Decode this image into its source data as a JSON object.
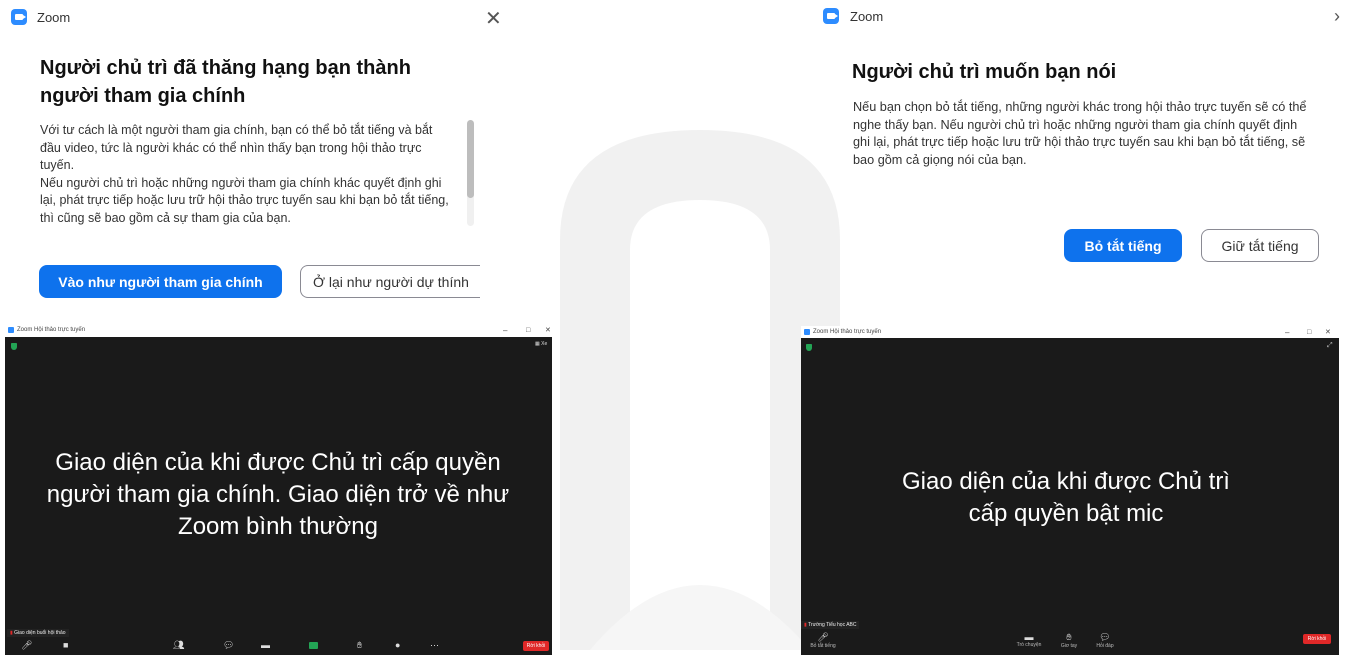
{
  "left_dialog": {
    "app_name": "Zoom",
    "title": "Người chủ trì đã thăng hạng bạn thành người tham gia chính",
    "body_p1": "Với tư cách là một người tham gia chính, bạn có thể bỏ tắt tiếng và bắt đầu video, tức là người khác có thể nhìn thấy bạn trong hội thảo trực tuyến.",
    "body_p2": "Nếu người chủ trì hoặc những người tham gia chính khác quyết định ghi lại, phát trực tiếp hoặc lưu trữ hội thảo trực tuyến sau khi bạn bỏ tắt tiếng, thì cũng sẽ bao gồm cả sự tham gia của bạn.",
    "primary_button": "Vào như người tham gia chính",
    "secondary_button": "Ở lại như người dự thính"
  },
  "right_dialog": {
    "app_name": "Zoom",
    "title": "Người chủ trì muốn bạn nói",
    "body": "Nếu bạn chọn bỏ tắt tiếng, những người khác trong hội thảo trực tuyến sẽ có thể nghe thấy bạn. Nếu người chủ trì hoặc những người tham gia chính quyết định ghi lại, phát trực tiếp hoặc lưu trữ hội thảo trực tuyến sau khi bạn bỏ tắt tiếng, sẽ bao gồm cả giọng nói của bạn.",
    "primary_button": "Bỏ tắt tiếng",
    "secondary_button": "Giữ tắt tiếng"
  },
  "left_window": {
    "title": "Zoom Hội thảo trực tuyến",
    "caption": "Giao diện của khi được Chủ trì cấp quyền người tham gia chính. Giao diện trở về như Zoom bình thường",
    "name_tag": "Giao diện buổi hội thảo",
    "view_label": "Xe",
    "leave": "Rời khỏi"
  },
  "right_window": {
    "title": "Zoom Hội thảo trực tuyến",
    "caption": "Giao diện của khi được Chủ trì cấp quyền bật mic",
    "name_tag": "Trường Tiểu học ABC",
    "toolbar": {
      "unmute": "Bỏ tắt tiếng",
      "chat": "Trò chuyện",
      "raise_hand": "Giơ tay",
      "qa": "Hỏi đáp"
    },
    "leave": "Rời khỏi"
  },
  "colors": {
    "accent": "#0e72ed",
    "zoom_blue": "#2d8cff",
    "leave_red": "#e02828",
    "window_bg": "#1a1a1a"
  }
}
